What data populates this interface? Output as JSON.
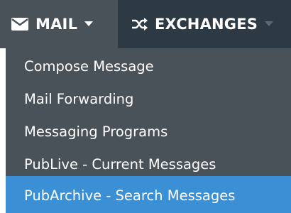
{
  "navbar": {
    "mail": {
      "label": "MAIL",
      "icon": "envelope-icon",
      "caret": "caret-down-icon"
    },
    "exchanges": {
      "label": "EXCHANGES",
      "icon": "shuffle-icon",
      "caret": "caret-down-icon"
    }
  },
  "menu": {
    "items": [
      {
        "label": "Compose Message",
        "active": false
      },
      {
        "label": "Mail Forwarding",
        "active": false
      },
      {
        "label": "Messaging Programs",
        "active": false
      },
      {
        "label": "PubLive - Current Messages",
        "active": false
      },
      {
        "label": "PubArchive - Search Messages",
        "active": true
      }
    ]
  },
  "colors": {
    "navbar_bg": "#2d3a43",
    "active_tab_bg": "#4a5259",
    "menu_bg": "#4a5259",
    "highlight": "#3b8fd4",
    "text": "#ffffff"
  }
}
